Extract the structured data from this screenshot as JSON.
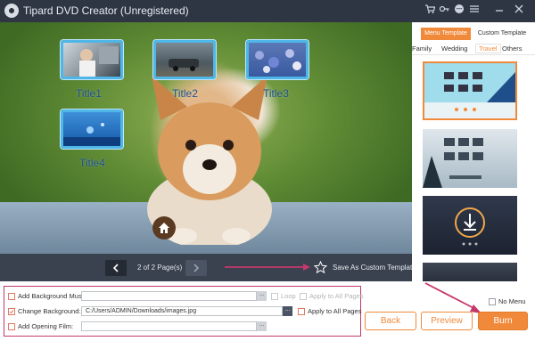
{
  "app": {
    "title": "Tipard DVD Creator (Unregistered)"
  },
  "titlebar_icons": [
    "cart-icon",
    "key-icon",
    "chat-icon",
    "menu-icon",
    "minimize-icon",
    "close-icon"
  ],
  "preview": {
    "titles": [
      {
        "label": "Title1",
        "thumb": "boy-in-car"
      },
      {
        "label": "Title2",
        "thumb": "car-on-road"
      },
      {
        "label": "Title3",
        "thumb": "flowers"
      },
      {
        "label": "Title4",
        "thumb": "underwater"
      }
    ],
    "home_icon": "home-icon"
  },
  "pagebar": {
    "page_text": "2 of 2 Page(s)",
    "save_label": "Save As Custom Template"
  },
  "right_panel": {
    "tabs": [
      "Menu Template",
      "Custom Template"
    ],
    "categories": [
      "Family",
      "Wedding",
      "Travel",
      "Others"
    ],
    "active_category": "Travel"
  },
  "options": {
    "bg_music": {
      "label": "Add Background Music:",
      "value": "",
      "loop_label": "Loop",
      "apply_label": "Apply to All Pages"
    },
    "bg_change": {
      "label": "Change Background:",
      "value": "C:/Users/ADMIN/Downloads/images.jpg",
      "apply_label": "Apply to All Pages"
    },
    "opening": {
      "label": "Add Opening Film:",
      "value": ""
    }
  },
  "actions": {
    "no_menu": "No Menu",
    "back": "Back",
    "preview": "Preview",
    "burn": "Burn"
  },
  "colors": {
    "accent": "#f08a3a",
    "highlight_pink": "#c5386b",
    "frame_blue": "#4fb6e8"
  }
}
